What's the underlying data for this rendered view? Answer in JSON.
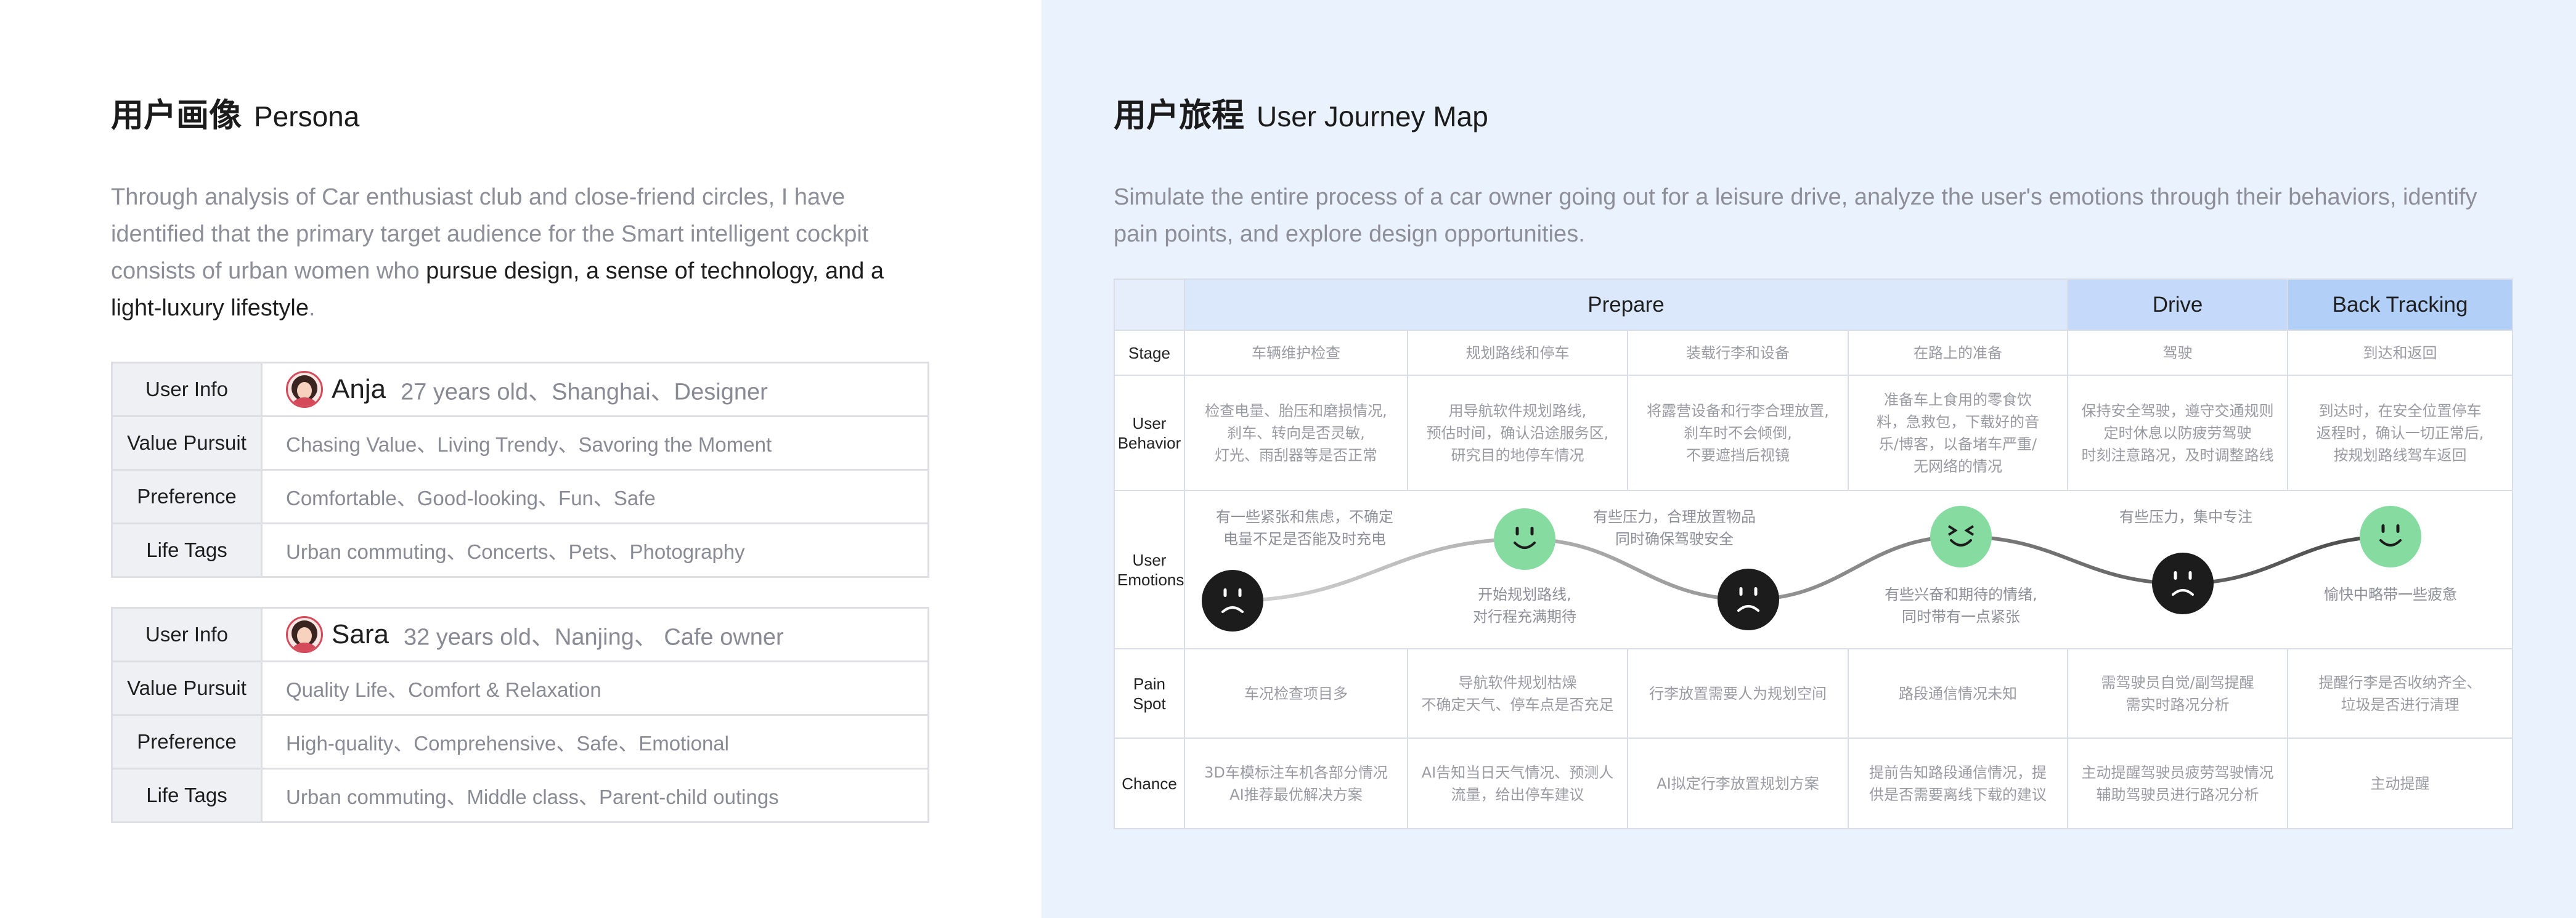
{
  "persona": {
    "title_cn": "用户画像",
    "title_en": "Persona",
    "intro_plain": "Through analysis of Car enthusiast club and close-friend circles, I have identified that the primary target audience for the Smart intelligent cockpit consists of urban women who ",
    "intro_highlight": "pursue design, a sense of technology, and a light-luxury lifestyle",
    "intro_end": ".",
    "labels": {
      "user_info": "User Info",
      "value_pursuit": "Value Pursuit",
      "preference": "Preference",
      "life_tags": "Life Tags"
    },
    "people": [
      {
        "name": "Anja",
        "info": "27 years old、Shanghai、Designer",
        "value_pursuit": "Chasing Value、Living Trendy、Savoring the Moment",
        "preference": "Comfortable、Good-looking、Fun、Safe",
        "life_tags": "Urban commuting、Concerts、Pets、Photography"
      },
      {
        "name": "Sara",
        "info": "32 years old、Nanjing、 Cafe owner",
        "value_pursuit": "Quality Life、Comfort & Relaxation",
        "preference": "High-quality、Comprehensive、Safe、Emotional",
        "life_tags": "Urban commuting、Middle class、Parent-child outings"
      }
    ]
  },
  "journey": {
    "title_cn": "用户旅程",
    "title_en": "User Journey Map",
    "intro": "Simulate the entire process of a car owner going out for a leisure drive, analyze the user's emotions through their behaviors, identify pain points, and explore design opportunities.",
    "phases": {
      "prepare": "Prepare",
      "drive": "Drive",
      "back": "Back Tracking"
    },
    "row_labels": {
      "stage": "Stage",
      "behavior_1": "User",
      "behavior_2": "Behavior",
      "emotions_1": "User",
      "emotions_2": "Emotions",
      "pain": "Pain Spot",
      "chance": "Chance"
    },
    "stages": [
      "车辆维护检查",
      "规划路线和停车",
      "装载行李和设备",
      "在路上的准备",
      "驾驶",
      "到达和返回"
    ],
    "behaviors": [
      [
        "检查电量、胎压和磨损情况,",
        "刹车、转向是否灵敏,",
        "灯光、雨刮器等是否正常"
      ],
      [
        "用导航软件规划路线,",
        "预估时间，确认沿途服务区,",
        "研究目的地停车情况"
      ],
      [
        "将露营设备和行李合理放置,",
        "刹车时不会倾倒,",
        "不要遮挡后视镜"
      ],
      [
        "准备车上食用的零食饮",
        "料，急救包，下载好的音",
        "乐/博客，以备堵车严重/",
        "无网络的情况"
      ],
      [
        "保持安全驾驶，遵守交通规则",
        "定时休息以防疲劳驾驶",
        "时刻注意路况，及时调整路线"
      ],
      [
        "到达时，在安全位置停车",
        "返程时，确认一切正常后,",
        "按规划路线驾车返回"
      ]
    ],
    "emotions": [
      {
        "lines": [
          "有一些紧张和焦虑，不确定",
          "电量不足是否能及时充电"
        ],
        "mood": "sad"
      },
      {
        "lines": [
          "开始规划路线,",
          "对行程充满期待"
        ],
        "mood": "happy"
      },
      {
        "lines": [
          "有些压力，合理放置物品",
          "同时确保驾驶安全"
        ],
        "mood": "sad"
      },
      {
        "lines": [
          "有些兴奋和期待的情绪,",
          "同时带有一点紧张"
        ],
        "mood": "excited"
      },
      {
        "lines": [
          "有些压力，集中专注"
        ],
        "mood": "sad"
      },
      {
        "lines": [
          "愉快中略带一些疲惫"
        ],
        "mood": "happy"
      }
    ],
    "pains": [
      [
        "车况检查项目多"
      ],
      [
        "导航软件规划枯燥",
        "不确定天气、停车点是否充足"
      ],
      [
        "行李放置需要人为规划空间"
      ],
      [
        "路段通信情况未知"
      ],
      [
        "需驾驶员自觉/副驾提醒",
        "需实时路况分析"
      ],
      [
        "提醒行李是否收纳齐全、",
        "垃圾是否进行清理"
      ]
    ],
    "chances": [
      [
        "3D车模标注车机各部分情况",
        "AI推荐最优解决方案"
      ],
      [
        "AI告知当日天气情况、预测人",
        "流量，给出停车建议"
      ],
      [
        "AI拟定行李放置规划方案"
      ],
      [
        "提前告知路段通信情况，提",
        "供是否需要离线下载的建议"
      ],
      [
        "主动提醒驾驶员疲劳驾驶情况",
        "辅助驾驶员进行路况分析"
      ],
      [
        "主动提醒"
      ]
    ]
  },
  "colors": {
    "left_bg": "#ffffff",
    "right_bg": "#eaf2fd",
    "happy_face": "#86dca0",
    "sad_face": "#1c1c1c",
    "curve_start": "#d2d2d2",
    "curve_end": "#4a4a4a"
  }
}
